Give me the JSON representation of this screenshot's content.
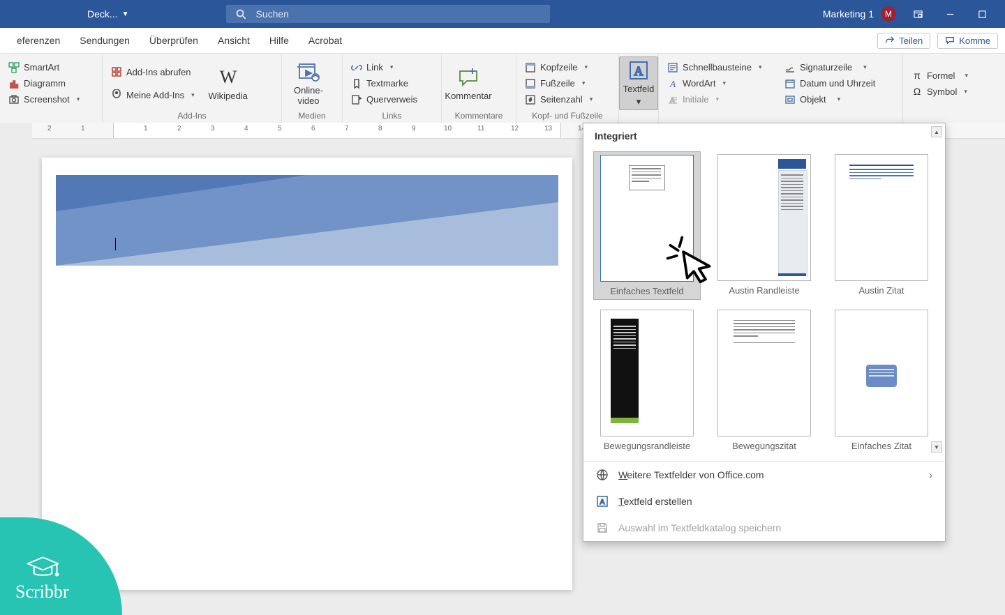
{
  "title": {
    "doc_name": "Deck...",
    "search_placeholder": "Suchen"
  },
  "user": {
    "name": "Marketing 1",
    "initial": "M"
  },
  "tabs": {
    "referenzen": "eferenzen",
    "sendungen": "Sendungen",
    "ueberpruefen": "Überprüfen",
    "ansicht": "Ansicht",
    "hilfe": "Hilfe",
    "acrobat": "Acrobat"
  },
  "header_buttons": {
    "share": "Teilen",
    "comment": "Komme"
  },
  "ribbon": {
    "illustr": {
      "smartart": "SmartArt",
      "diagramm": "Diagramm",
      "screenshot": "Screenshot"
    },
    "addins_title": "Add-Ins",
    "addins": {
      "get": "Add-Ins abrufen",
      "my": "Meine Add-Ins"
    },
    "wikipedia": "Wikipedia",
    "medien_title": "Medien",
    "onlinevideo": "Online-\nvideo",
    "links_title": "Links",
    "link": "Link",
    "textmarke": "Textmarke",
    "querverweis": "Querverweis",
    "kommentare_title": "Kommentare",
    "kommentar": "Kommentar",
    "kopf_title": "Kopf- und Fußzeile",
    "kopfzeile": "Kopfzeile",
    "fusszeile": "Fußzeile",
    "seitenzahl": "Seitenzahl",
    "textfeld": "Textfeld",
    "text": {
      "schnell": "Schnellbausteine",
      "wordart": "WordArt",
      "initiale": "Initiale"
    },
    "datetime": {
      "signatur": "Signaturzeile",
      "datum": "Datum und Uhrzeit",
      "objekt": "Objekt"
    },
    "symbols": {
      "formel": "Formel",
      "symbol": "Symbol"
    }
  },
  "gallery": {
    "heading": "Integriert",
    "items": [
      {
        "label": "Einfaches Textfeld"
      },
      {
        "label": "Austin Randleiste"
      },
      {
        "label": "Austin Zitat"
      },
      {
        "label": "Bewegungsrandleiste"
      },
      {
        "label": "Bewegungszitat"
      },
      {
        "label": "Einfaches Zitat"
      }
    ],
    "more": "Weitere Textfelder von Office.com",
    "draw": "Textfeld erstellen",
    "save": "Auswahl im Textfeldkatalog speichern"
  },
  "scribbr": "Scribbr",
  "ruler_ticks": [
    -2,
    -1,
    "",
    1,
    2,
    3,
    4,
    5,
    6,
    7,
    8,
    9,
    10,
    11,
    12,
    13,
    14
  ]
}
